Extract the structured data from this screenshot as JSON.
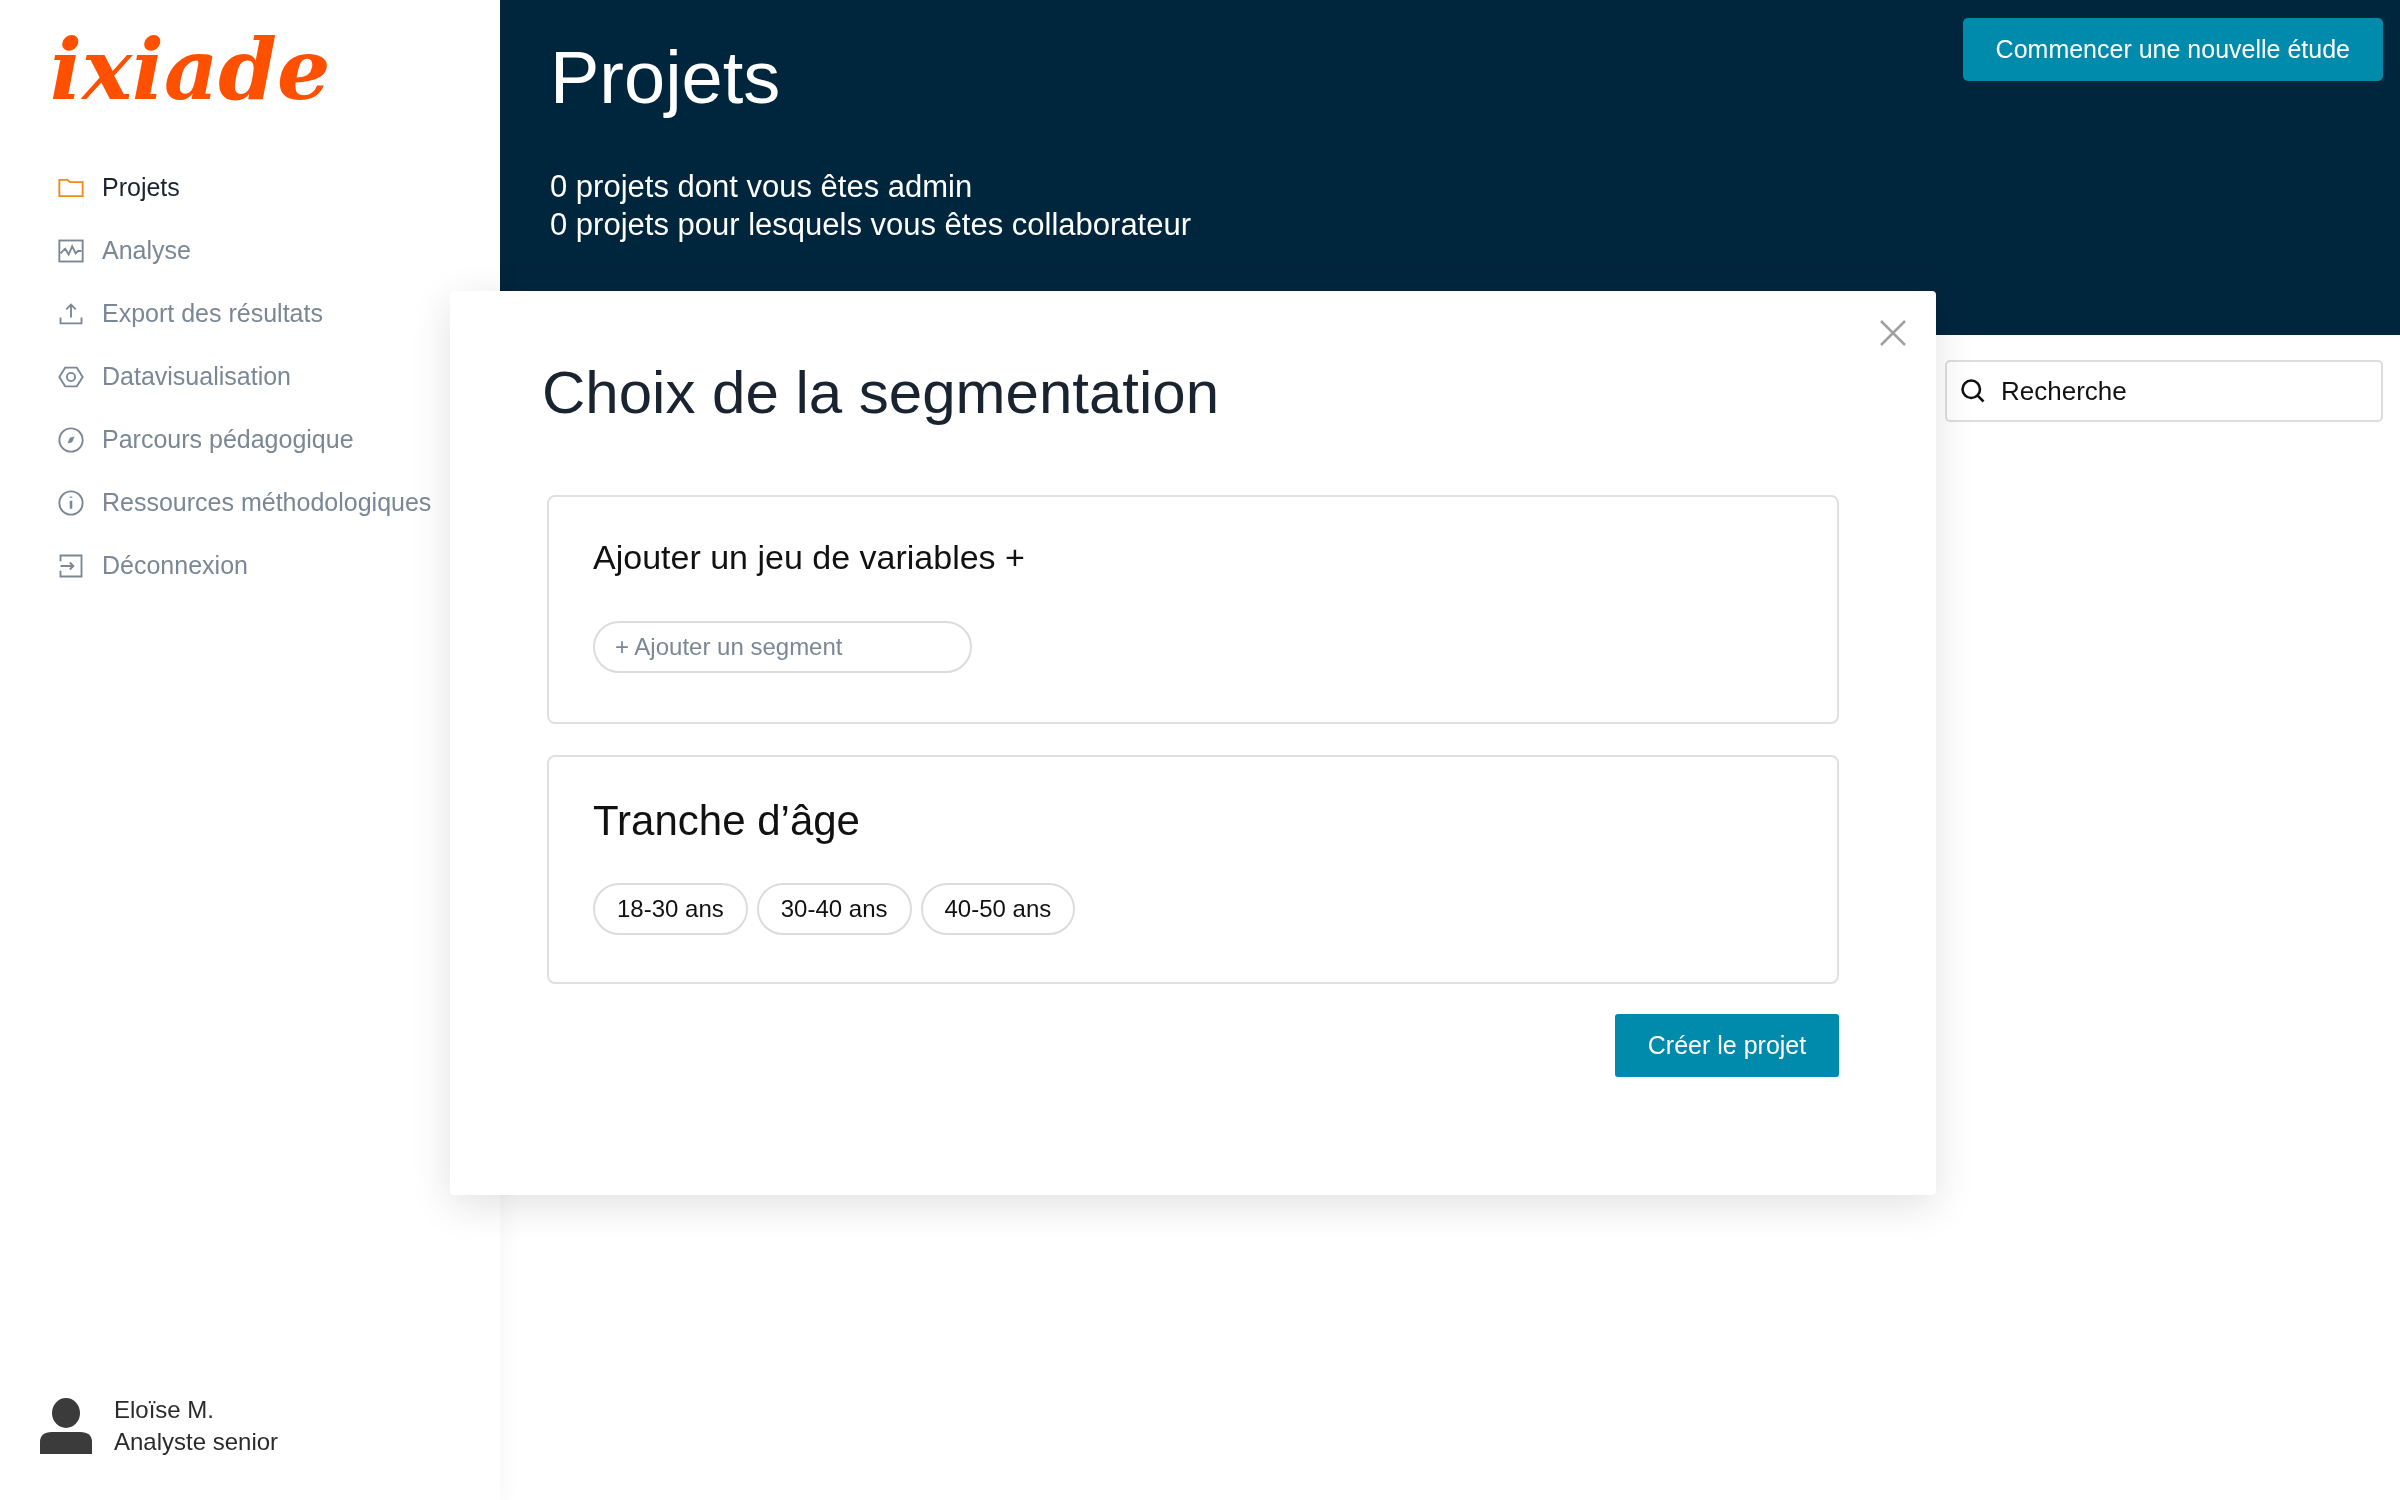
{
  "logo": "ixiade",
  "sidebar": {
    "items": [
      {
        "label": "Projets",
        "kind": "folder",
        "selected": true
      },
      {
        "label": "Analyse",
        "kind": "chart",
        "selected": false
      },
      {
        "label": "Export des résultats",
        "kind": "upload",
        "selected": false
      },
      {
        "label": "Datavisualisation",
        "kind": "hexagon",
        "selected": false
      },
      {
        "label": "Parcours pédagogique",
        "kind": "compass",
        "selected": false
      },
      {
        "label": "Ressources méthodologiques",
        "kind": "info",
        "selected": false
      },
      {
        "label": "Déconnexion",
        "kind": "logout",
        "selected": false
      }
    ]
  },
  "user": {
    "name": "Eloïse M.",
    "role": "Analyste senior"
  },
  "header": {
    "title": "Projets",
    "stats": [
      "0 projets dont vous êtes admin",
      "0 projets pour lesquels vous êtes collaborateur"
    ],
    "button": "Commencer une nouvelle étude"
  },
  "search": {
    "placeholder": "Recherche"
  },
  "dialog": {
    "title": "Choix de la segmentation",
    "cards": [
      {
        "kind": "add",
        "heading": "Ajouter un jeu de variables +",
        "action": "+ Ajouter un segment"
      },
      {
        "kind": "chips",
        "heading": "Tranche d’âge",
        "chips": [
          "18-30 ans",
          "30-40 ans",
          "40-50 ans"
        ]
      }
    ],
    "button": "Créer le projet"
  }
}
